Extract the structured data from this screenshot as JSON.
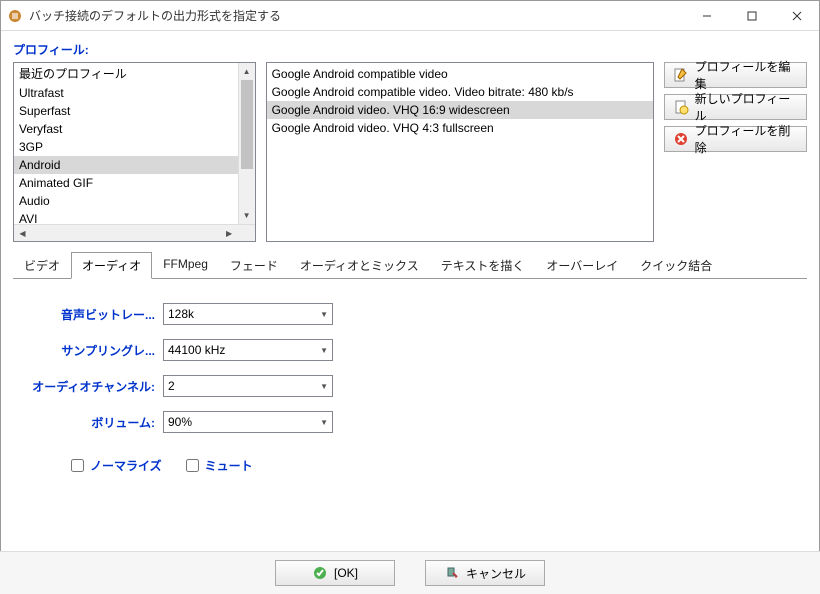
{
  "window": {
    "title": "バッチ接続のデフォルトの出力形式を指定する"
  },
  "profile_label": "プロフィール:",
  "left_list": {
    "items": [
      "最近のプロフィール",
      "Ultrafast",
      "Superfast",
      "Veryfast",
      "3GP",
      "Android",
      "Animated GIF",
      "Audio",
      "AVI"
    ],
    "selected_index": 5
  },
  "right_list": {
    "items": [
      "Google Android compatible video",
      "Google Android compatible video. Video bitrate: 480 kb/s",
      "Google Android video. VHQ 16:9 widescreen",
      "Google Android video. VHQ 4:3 fullscreen"
    ],
    "selected_index": 2
  },
  "buttons": {
    "edit_profile": "プロフィールを編集",
    "new_profile": "新しいプロフィール",
    "delete_profile": "プロフィールを削除"
  },
  "tabs": {
    "items": [
      "ビデオ",
      "オーディオ",
      "FFMpeg",
      "フェード",
      "オーディオとミックス",
      "テキストを描く",
      "オーバーレイ",
      "クイック結合"
    ],
    "active_index": 1
  },
  "audio": {
    "bitrate_label": "音声ビットレー...",
    "bitrate_value": "128k",
    "sampling_label": "サンプリングレ...",
    "sampling_value": "44100 kHz",
    "channels_label": "オーディオチャンネル:",
    "channels_value": "2",
    "volume_label": "ボリューム:",
    "volume_value": "90%",
    "normalize_label": "ノーマライズ",
    "mute_label": "ミュート"
  },
  "dialog": {
    "ok": "[OK]",
    "cancel": "キャンセル"
  }
}
